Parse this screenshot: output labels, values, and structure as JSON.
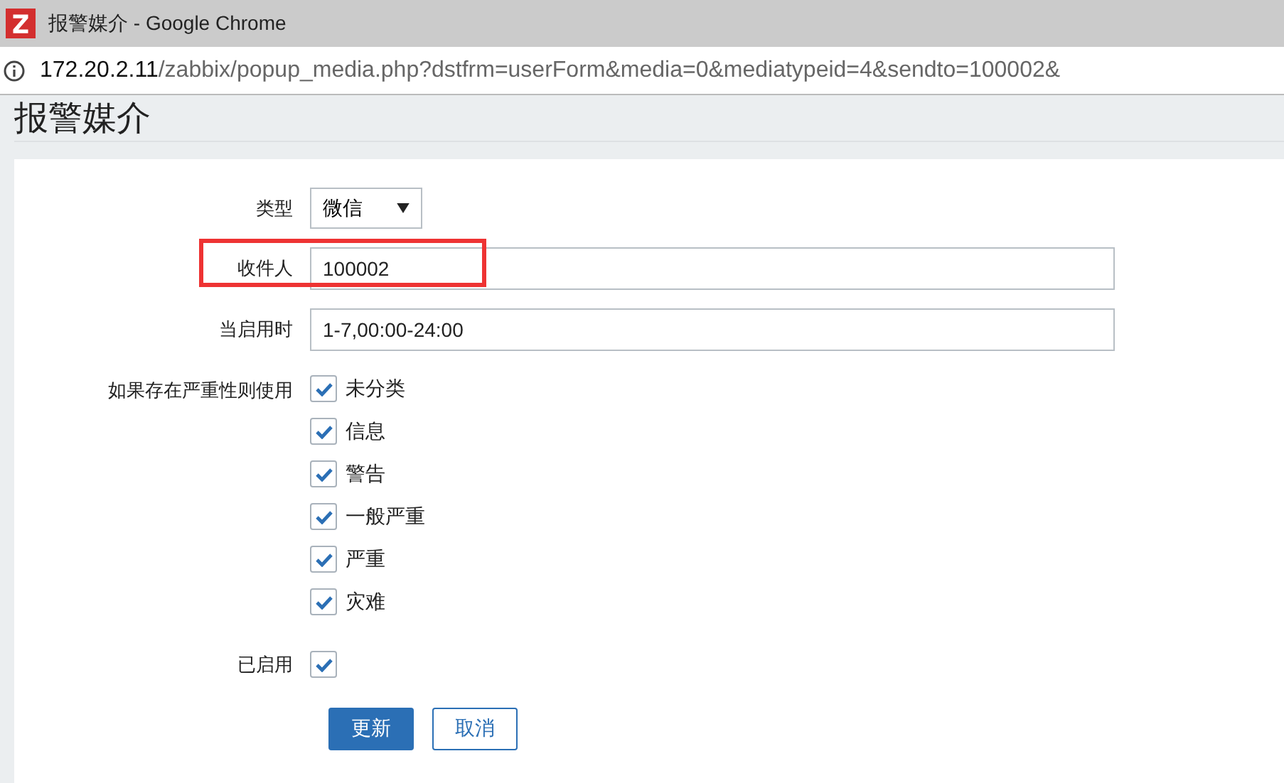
{
  "window": {
    "title": "报警媒介 - Google Chrome"
  },
  "address_bar": {
    "host": "172.20.2.11",
    "path": "/zabbix/popup_media.php?dstfrm=userForm&media=0&mediatypeid=4&sendto=100002&"
  },
  "page": {
    "heading": "报警媒介"
  },
  "form": {
    "fields": [
      {
        "kind": "select",
        "label": "类型",
        "value": "微信",
        "highlighted": false
      },
      {
        "kind": "text",
        "label": "收件人",
        "value": "100002",
        "highlighted": true
      },
      {
        "kind": "text",
        "label": "当启用时",
        "value": "1-7,00:00-24:00",
        "highlighted": false
      }
    ],
    "severity": {
      "label": "如果存在严重性则使用",
      "options": [
        {
          "label": "未分类",
          "checked": true
        },
        {
          "label": "信息",
          "checked": true
        },
        {
          "label": "警告",
          "checked": true
        },
        {
          "label": "一般严重",
          "checked": true
        },
        {
          "label": "严重",
          "checked": true
        },
        {
          "label": "灾难",
          "checked": true
        }
      ]
    },
    "enabled": {
      "label": "已启用",
      "checked": true
    },
    "buttons": [
      {
        "label": "更新",
        "primary": true
      },
      {
        "label": "取消",
        "primary": false
      }
    ]
  }
}
